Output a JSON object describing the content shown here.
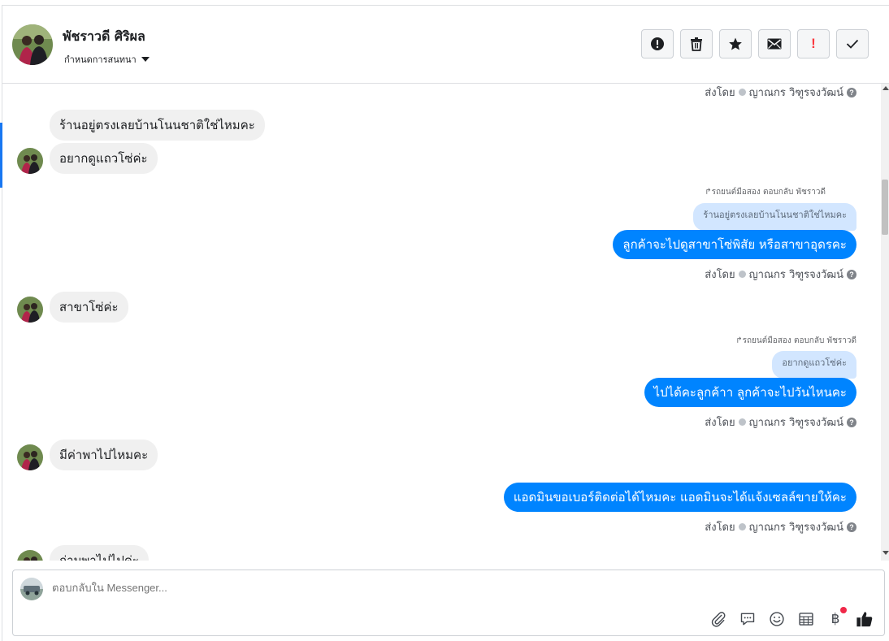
{
  "header": {
    "contact_name": "พัชราวดี ศิริผล",
    "assign_label": "กำหนดการสนทนา",
    "toolbar": [
      {
        "name": "spam-alert-button",
        "icon": "alert-circle-icon"
      },
      {
        "name": "delete-button",
        "icon": "trash-icon"
      },
      {
        "name": "star-button",
        "icon": "star-icon"
      },
      {
        "name": "mark-unread-button",
        "icon": "envelope-icon"
      },
      {
        "name": "flag-follow-up-button",
        "icon": "exclamation-icon",
        "glyph": "!"
      },
      {
        "name": "mark-done-button",
        "icon": "check-icon"
      }
    ]
  },
  "conversation": {
    "sent_by_prefix": "ส่งโดย",
    "sender_name": "ญาณกร วิฑูรจงวัฒน์",
    "messages": [
      {
        "dir": "meta",
        "text": "ส่งโดย ญาณกร วิฑูรจงวัฒน์"
      },
      {
        "dir": "in",
        "text": "ร้านอยู่ตรงเลยบ้านโนนชาติใช่ไหมคะ",
        "avatar": false
      },
      {
        "dir": "in",
        "text": "อยากดูแถวโซ่ค่ะ",
        "avatar": true
      },
      {
        "dir": "out",
        "reply_header": "รถยนต์มือสอง ตอบกลับ พัชราวดี",
        "quote": "ร้านอยู่ตรงเลยบ้านโนนชาติใช่ไหมคะ",
        "text": "ลูกค้าจะไปดูสาขาโซ่พิสัย หรือสาขาอุดรคะ"
      },
      {
        "dir": "in",
        "text": "สาขาโซ่ค่ะ",
        "avatar": true
      },
      {
        "dir": "out",
        "reply_header": "รถยนต์มือสอง ตอบกลับ พัชราวดี",
        "quote": "อยากดูแถวโซ่ค่ะ",
        "text": "ไปได้คะลูกค้าา ลูกค้าจะไปวันไหนคะ"
      },
      {
        "dir": "in",
        "text": "มีค่าพาไปไหมคะ",
        "avatar": true
      },
      {
        "dir": "out",
        "text": "แอดมินขอเบอร์ติดต่อได้ไหมคะ แอดมินจะได้แจ้งเซลล์ขายให้คะ"
      },
      {
        "dir": "in",
        "text": "ถ่ามพาไปไปค่ะ",
        "avatar": true,
        "partial": true
      }
    ]
  },
  "composer": {
    "placeholder": "ตอบกลับใน Messenger...",
    "tools": [
      "paperclip-icon",
      "saved-replies-icon",
      "emoji-icon",
      "appointment-icon",
      "baht-payment-icon",
      "like-thumb-icon"
    ],
    "baht_glyph": "฿"
  },
  "colors": {
    "outgoing_bubble": "#0084ff",
    "incoming_bubble": "#f0f0f0",
    "quote_bubble": "#d2e6ff",
    "accent": "#1877f2",
    "flag_red": "#fa383e"
  }
}
